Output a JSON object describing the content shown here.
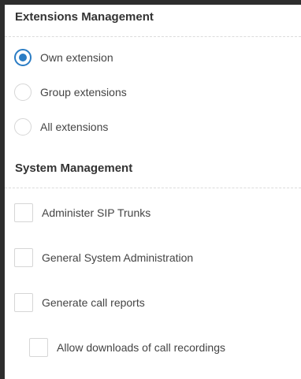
{
  "extensions_management": {
    "title": "Extensions Management",
    "options": [
      {
        "label": "Own extension",
        "selected": true
      },
      {
        "label": "Group extensions",
        "selected": false
      },
      {
        "label": "All extensions",
        "selected": false
      }
    ]
  },
  "system_management": {
    "title": "System Management",
    "checkboxes": [
      {
        "label": "Administer SIP Trunks",
        "checked": false
      },
      {
        "label": "General System Administration",
        "checked": false
      },
      {
        "label": "Generate call reports",
        "checked": false
      },
      {
        "label": "Allow downloads of call recordings",
        "checked": false
      }
    ]
  },
  "colors": {
    "accent": "#2a7cc4",
    "border": "#d6d6d6",
    "background": "#ffffff",
    "frame": "#2d2d2d"
  }
}
